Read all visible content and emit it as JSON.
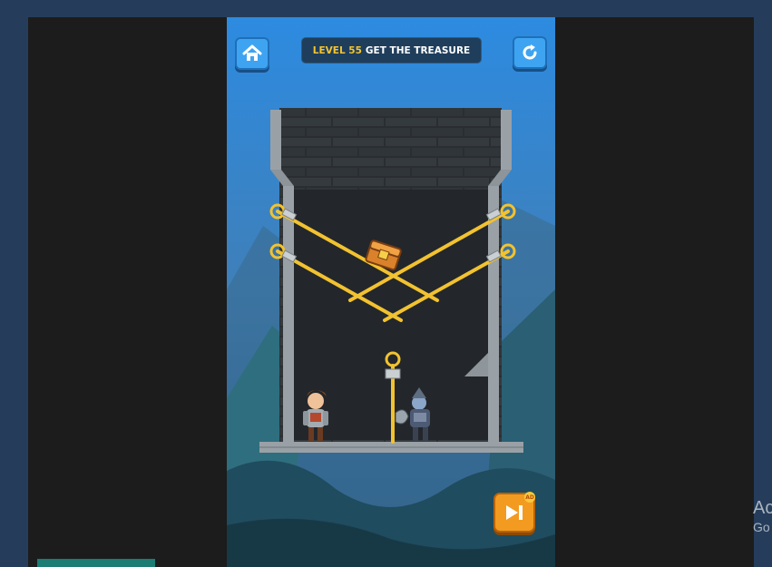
{
  "top_bar": {
    "level_label": "LEVEL 55",
    "objective": "GET THE TREASURE"
  },
  "skip_button": {
    "badge": "AD"
  },
  "ad_overlay": {
    "line1": "Ac",
    "line2": "Go"
  },
  "icons": {
    "home": "home-icon",
    "restart": "restart-icon",
    "skip": "skip-forward-icon"
  },
  "colors": {
    "button_blue": "#3ea4f2",
    "pin_gold": "#f2c230",
    "skip_orange": "#f39b20",
    "tower_dark": "#2c2f33"
  }
}
